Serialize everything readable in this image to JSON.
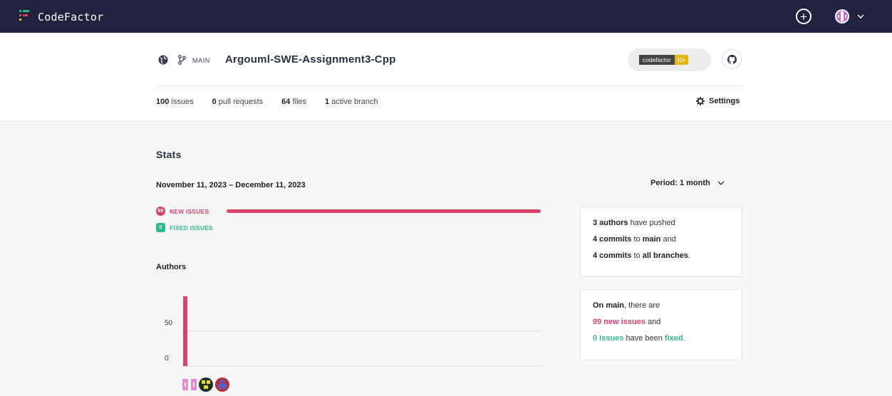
{
  "app": {
    "brand": "CodeFactor"
  },
  "topbar": {
    "plus_label": "+"
  },
  "repo": {
    "branch": "MAIN",
    "name": "Argouml-SWE-Assignment3-Cpp",
    "badge_left": "codefactor",
    "badge_right": "C+"
  },
  "stats": {
    "issues_count": "100",
    "issues_label": "issues",
    "pr_count": "0",
    "pr_label": "pull requests",
    "files_count": "64",
    "files_label": "files",
    "branch_count": "1",
    "branch_label": "active branch",
    "settings_label": "Settings"
  },
  "section": {
    "title": "Stats",
    "date_range": "November 11, 2023 – December 11, 2023",
    "period_label": "Period: 1 month"
  },
  "issues": {
    "new_count": "99",
    "new_label": "NEW ISSUES",
    "new_fraction": 1.0,
    "fixed_count": "0",
    "fixed_label": "FIXED ISSUES"
  },
  "authors": {
    "title": "Authors"
  },
  "chart_data": {
    "type": "bar",
    "categories": [
      "author-1",
      "author-2",
      "author-3"
    ],
    "values": [
      99,
      0,
      0
    ],
    "yticks": [
      "50",
      "0"
    ],
    "ylim": [
      0,
      99
    ]
  },
  "card1": {
    "line1_bold": "3 authors",
    "line1_rest": " have pushed",
    "line2_bold1": "4 commits",
    "line2_mid": " to ",
    "line2_bold2": "main",
    "line2_rest": " and",
    "line3_bold1": "4 commits",
    "line3_mid": " to ",
    "line3_bold2": "all branches",
    "line3_rest": "."
  },
  "card2": {
    "line1_bold": "On main",
    "line1_rest": ", there are",
    "line2_pink": "99 new issues",
    "line2_rest": " and",
    "line3_green": "0 issues",
    "line3_mid": " have been ",
    "line3_green2": "fixed",
    "line3_rest": "."
  },
  "colors": {
    "topbar": "#20223f",
    "new_issues": "#d84468",
    "fixed_issues": "#2eb886",
    "badge_grade": "#e7b416"
  }
}
